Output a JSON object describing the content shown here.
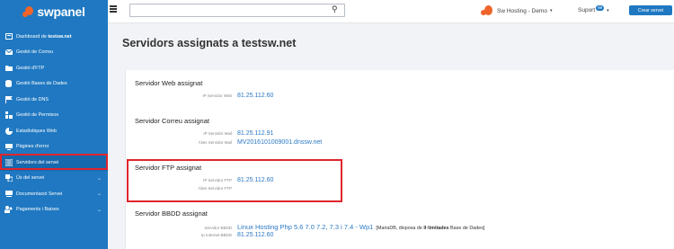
{
  "brand": {
    "name": "swpanel"
  },
  "sidebar": {
    "items": [
      {
        "label": "Dashboard de ",
        "bold": "testsw.net",
        "icon": "dashboard-icon"
      },
      {
        "label": "Gestió de Correu",
        "icon": "mail-icon"
      },
      {
        "label": "Gestió d'FTP",
        "icon": "ftp-icon"
      },
      {
        "label": "Gestió Bases de Dades",
        "icon": "database-icon"
      },
      {
        "label": "Gestió de DNS",
        "icon": "flag-icon"
      },
      {
        "label": "Gestió de Permisos",
        "icon": "permissions-icon"
      },
      {
        "label": "Estadístiques Web",
        "icon": "stats-icon"
      },
      {
        "label": "Pàgines d'error",
        "icon": "error-page-icon"
      },
      {
        "label": "Servidors del servei",
        "icon": "servers-icon"
      },
      {
        "label": "Ús del servei",
        "icon": "usage-icon"
      },
      {
        "label": "Documentació Servei",
        "icon": "docs-icon"
      },
      {
        "label": "Pagaments i Baixes",
        "icon": "payments-icon"
      }
    ]
  },
  "topbar": {
    "search_placeholder": "",
    "user_label": "Sw Hosting - Demo",
    "user_caret": "▾",
    "support_label": "Suport",
    "support_badge": "99",
    "support_caret": "▾",
    "new_service_label": "Crear servei"
  },
  "page": {
    "title_prefix": "Servidors assignats a ",
    "title_domain": "testsw.net"
  },
  "sections": {
    "web": {
      "title": "Servidor Web assignat",
      "ip_label": "IP Servidor Web",
      "ip_value": "81.25.112.60"
    },
    "mail": {
      "title": "Servidor Correu assignat",
      "ip_label": "IP Servidor Mail",
      "ip_value": "81.25.112.91",
      "alias_label": "Àlies Servidor Mail",
      "alias_value": "MV2016101009001.dnssw.net"
    },
    "ftp": {
      "title": "Servidor FTP assignat",
      "ip_label": "IP Servidor FTP",
      "ip_value": "81.25.112.60",
      "alias_label": "Àlies Servidor FTP",
      "alias_value": ""
    },
    "db": {
      "title": "Servidor BBDD assignat",
      "server_label": "Servidor BBDD",
      "server_value": "Linux Hosting Php 5.6 7.0 7.2, 7.3 i 7.4 - Wp1",
      "server_note_prefix": "[MariaDB, disposa de ",
      "server_note_bold": "Il·limitades",
      "server_note_suffix": " Base de Dades]",
      "ip_label": "Ip Internet BBDD",
      "ip_value": "81.25.112.60"
    }
  },
  "colors": {
    "sidebar": "#1f78c1",
    "accent": "#1f78c1",
    "brand_orange": "#f0642a",
    "highlight_red": "#e0252b",
    "link_blue": "#2a78c4"
  }
}
